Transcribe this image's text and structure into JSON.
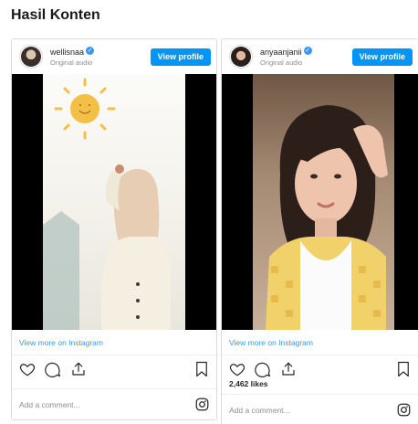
{
  "page": {
    "title": "Hasil Konten"
  },
  "posts": [
    {
      "username": "wellisnaa",
      "subtitle": "Original audio",
      "profile_button": "View profile",
      "view_more": "View more on Instagram",
      "likes": "",
      "comment_placeholder": "Add a comment..."
    },
    {
      "username": "anyaanjanii",
      "subtitle": "Original audio",
      "profile_button": "View profile",
      "view_more": "View more on Instagram",
      "likes": "2,462 likes",
      "comment_placeholder": "Add a comment..."
    }
  ],
  "icons": {
    "verified": "verified-badge-icon",
    "like": "heart-icon",
    "comment": "comment-icon",
    "share": "share-icon",
    "save": "bookmark-icon",
    "instagram": "instagram-icon"
  },
  "colors": {
    "accent": "#0095f6",
    "link": "#3897f0",
    "text": "#262626",
    "muted": "#8e8e8e"
  }
}
